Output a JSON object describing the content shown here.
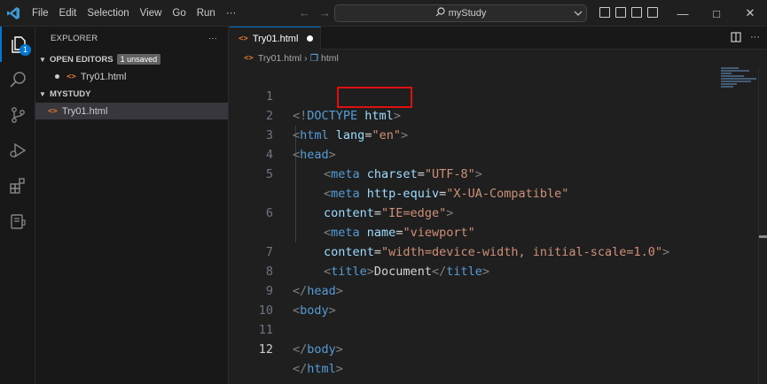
{
  "titlebar": {
    "menu": [
      "File",
      "Edit",
      "Selection",
      "View",
      "Go",
      "Run",
      "···"
    ],
    "search_text": "myStudy"
  },
  "activity_bar": {
    "icons": [
      "explorer-icon",
      "search-icon",
      "source-control-icon",
      "run-debug-icon",
      "extensions-icon",
      "remote-icon"
    ],
    "explorer_badge": "1"
  },
  "sidebar": {
    "title": "EXPLORER",
    "more": "···",
    "open_editors_label": "OPEN EDITORS",
    "unsaved_badge": "1 unsaved",
    "open_editor_file": "Try01.html",
    "folder_label": "MYSTUDY",
    "folder_file": "Try01.html"
  },
  "tab": {
    "label": "Try01.html"
  },
  "breadcrumb": {
    "file": "Try01.html",
    "symbol": "html"
  },
  "editor": {
    "line_numbers": [
      "1",
      "2",
      "3",
      "4",
      "5",
      "",
      "6",
      "",
      "7",
      "8",
      "9",
      "10",
      "11",
      "12"
    ],
    "lines": {
      "l1": {
        "open": "<!",
        "kw": "DOCTYPE",
        "rest": " html",
        "close": ">"
      },
      "l2": {
        "open": "<",
        "tag": "html",
        "attr": "lang",
        "eq": "=",
        "val": "\"en\"",
        "close": ">"
      },
      "l3": {
        "open": "<",
        "tag": "head",
        "close": ">"
      },
      "l4": {
        "open": "<",
        "tag": "meta",
        "attr": "charset",
        "eq": "=",
        "val": "\"UTF-8\"",
        "close": ">"
      },
      "l5": {
        "open": "<",
        "tag": "meta",
        "attr": "http-equiv",
        "eq": "=",
        "val": "\"X-UA-Compatible\""
      },
      "l5b": {
        "attr": "content",
        "eq": "=",
        "val": "\"IE=edge\"",
        "close": ">"
      },
      "l6": {
        "open": "<",
        "tag": "meta",
        "attr": "name",
        "eq": "=",
        "val": "\"viewport\""
      },
      "l6b": {
        "attr": "content",
        "eq": "=",
        "val": "\"width=device-width, initial-scale=1.0\"",
        "close": ">"
      },
      "l7": {
        "open": "<",
        "tag": "title",
        "close": ">",
        "text": "Document",
        "open2": "</",
        "tag2": "title",
        "close2": ">"
      },
      "l8": {
        "open": "</",
        "tag": "head",
        "close": ">"
      },
      "l9": {
        "open": "<",
        "tag": "body",
        "close": ">"
      },
      "l11": {
        "open": "</",
        "tag": "body",
        "close": ">"
      },
      "l12": {
        "open": "</",
        "tag": "html",
        "close": ">"
      }
    }
  },
  "colors": {
    "accent": "#0078d4",
    "highlight_box": "#e01010",
    "tag": "#569cd6",
    "attribute": "#9cdcfe",
    "string": "#ce9178",
    "html_file_icon": "#e37933"
  }
}
